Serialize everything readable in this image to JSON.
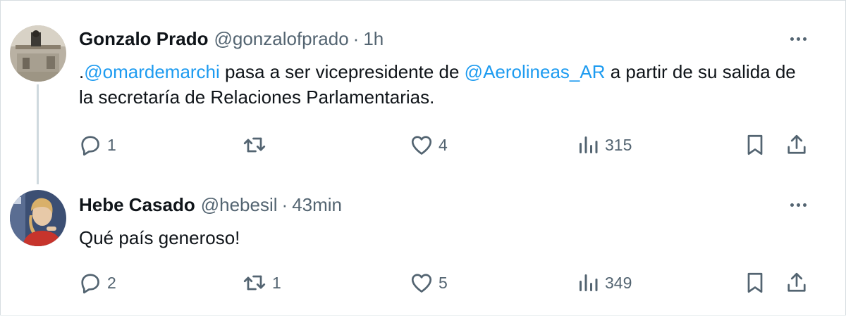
{
  "colors": {
    "link": "#1d9bf0",
    "secondary_text": "#536471",
    "primary_text": "#0f1419",
    "thread_line": "#cfd9de"
  },
  "tweets": [
    {
      "display_name": "Gonzalo Prado",
      "handle": "@gonzalofprado",
      "separator": "·",
      "time": "1h",
      "text": {
        "prefix": ".",
        "mention_1": "@omardemarchi",
        "middle": " pasa a ser vicepresidente de ",
        "mention_2": "@Aerolineas_AR",
        "suffix": " a partir de su salida de la secretaría de Relaciones Parlamentarias."
      },
      "stats": {
        "replies": "1",
        "retweets": "",
        "likes": "4",
        "views": "315"
      },
      "icons": [
        "reply-icon",
        "retweet-icon",
        "like-icon",
        "views-icon",
        "bookmark-icon",
        "share-icon",
        "more-icon"
      ]
    },
    {
      "display_name": "Hebe Casado",
      "handle": "@hebesil",
      "separator": "·",
      "time": "43min",
      "text": {
        "body": "Qué país generoso!"
      },
      "stats": {
        "replies": "2",
        "retweets": "1",
        "likes": "5",
        "views": "349"
      },
      "icons": [
        "reply-icon",
        "retweet-icon",
        "like-icon",
        "views-icon",
        "bookmark-icon",
        "share-icon",
        "more-icon"
      ]
    }
  ]
}
